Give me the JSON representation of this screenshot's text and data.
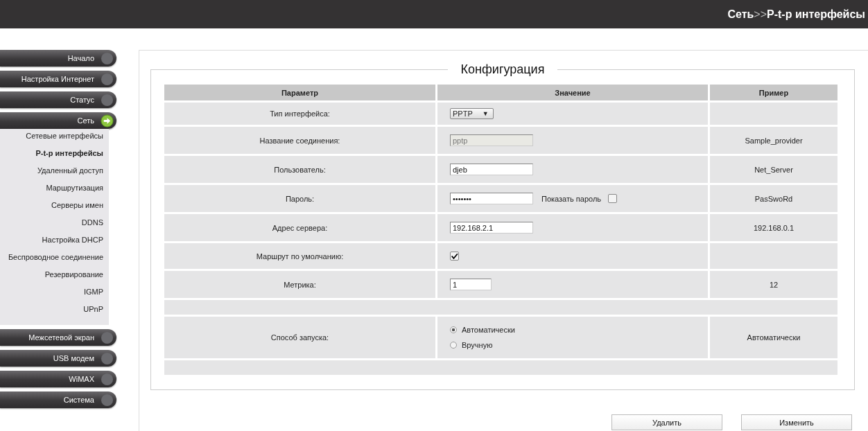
{
  "header": {
    "breadcrumb": {
      "section": "Сеть",
      "separator": ">>",
      "page": "P-t-p интерфейсы"
    }
  },
  "menu": [
    {
      "label": "Начало",
      "selected": false
    },
    {
      "label": "Настройка Интернет",
      "selected": false
    },
    {
      "label": "Статус",
      "selected": false
    },
    {
      "label": "Сеть",
      "selected": true,
      "expanded": true,
      "children": [
        {
          "label": "Сетевые интерфейсы",
          "selected": false
        },
        {
          "label": "P-t-p интерфейсы",
          "selected": true
        },
        {
          "label": "Удаленный доступ",
          "selected": false
        },
        {
          "label": "Маршрутизация",
          "selected": false
        },
        {
          "label": "Серверы имен",
          "selected": false
        },
        {
          "label": "DDNS",
          "selected": false
        },
        {
          "label": "Настройка DHCP",
          "selected": false
        },
        {
          "label": "Беспроводное соединение",
          "selected": false
        },
        {
          "label": "Резервирование",
          "selected": false
        },
        {
          "label": "IGMP",
          "selected": false
        },
        {
          "label": "UPnP",
          "selected": false
        }
      ]
    },
    {
      "label": "Межсетевой экран",
      "selected": false
    },
    {
      "label": "USB модем",
      "selected": false
    },
    {
      "label": "WiMAX",
      "selected": false
    },
    {
      "label": "Система",
      "selected": false
    }
  ],
  "config": {
    "title": "Конфигурация",
    "columns": [
      "Параметр",
      "Значение",
      "Пример"
    ],
    "rows": [
      {
        "kind": "select",
        "label": "Тип интерфейса:",
        "value": "PPTP",
        "arrow": "▼"
      },
      {
        "kind": "text",
        "label": "Название соединения:",
        "value": "pptp",
        "disabled": true,
        "example": "Sample_provider"
      },
      {
        "kind": "text",
        "label": "Пользователь:",
        "value": "djeb",
        "disabled": false,
        "example": "Net_Server"
      },
      {
        "kind": "password",
        "label": "Пароль:",
        "value": "•••••••",
        "show_label": "Показать пароль",
        "show_checked": false,
        "example": "PasSwoRd"
      },
      {
        "kind": "text",
        "label": "Адрес сервера:",
        "value": "192.168.2.1",
        "disabled": false,
        "example": "192.168.0.1"
      },
      {
        "kind": "checkbox",
        "label": "Маршрут по умолчанию:",
        "checked": true
      },
      {
        "kind": "short",
        "label": "Метрика:",
        "value": "1",
        "example": "12"
      },
      {
        "kind": "empty"
      },
      {
        "kind": "radio",
        "label": "Способ запуска:",
        "options": [
          {
            "label": "Автоматически",
            "selected": true
          },
          {
            "label": "Вручную",
            "selected": false
          }
        ],
        "example": "Автоматически"
      }
    ]
  },
  "buttons": [
    "Удалить",
    "Изменить"
  ]
}
